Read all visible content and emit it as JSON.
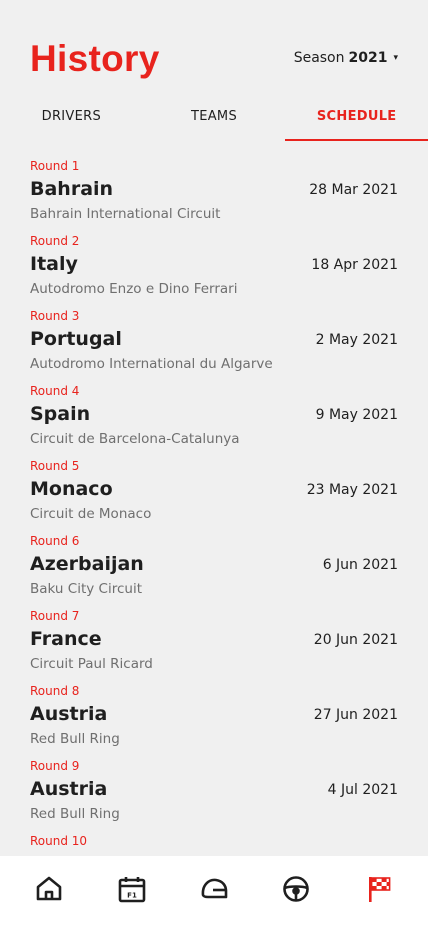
{
  "header": {
    "title": "History",
    "season_label": "Season",
    "season_year": "2021",
    "caret": "▾"
  },
  "tabs": [
    {
      "label": "DRIVERS",
      "active": false
    },
    {
      "label": "TEAMS",
      "active": false
    },
    {
      "label": "SCHEDULE",
      "active": true
    }
  ],
  "races": [
    {
      "round": "Round 1",
      "country": "Bahrain",
      "date": "28 Mar 2021",
      "circuit": "Bahrain International Circuit"
    },
    {
      "round": "Round 2",
      "country": "Italy",
      "date": "18 Apr 2021",
      "circuit": "Autodromo Enzo e Dino Ferrari"
    },
    {
      "round": "Round 3",
      "country": "Portugal",
      "date": "2 May 2021",
      "circuit": "Autodromo International du Algarve"
    },
    {
      "round": "Round 4",
      "country": "Spain",
      "date": "9 May 2021",
      "circuit": "Circuit de Barcelona-Catalunya"
    },
    {
      "round": "Round 5",
      "country": "Monaco",
      "date": "23 May 2021",
      "circuit": "Circuit de Monaco"
    },
    {
      "round": "Round 6",
      "country": "Azerbaijan",
      "date": "6 Jun 2021",
      "circuit": "Baku City Circuit"
    },
    {
      "round": "Round 7",
      "country": "France",
      "date": "20 Jun 2021",
      "circuit": "Circuit Paul Ricard"
    },
    {
      "round": "Round 8",
      "country": "Austria",
      "date": "27 Jun 2021",
      "circuit": "Red Bull Ring"
    },
    {
      "round": "Round 9",
      "country": "Austria",
      "date": "4 Jul 2021",
      "circuit": "Red Bull Ring"
    },
    {
      "round": "Round 10",
      "country": "",
      "date": "",
      "circuit": ""
    }
  ],
  "nav": [
    {
      "icon": "home-icon",
      "active": false
    },
    {
      "icon": "calendar-f1-icon",
      "active": false
    },
    {
      "icon": "helmet-icon",
      "active": false
    },
    {
      "icon": "steering-wheel-icon",
      "active": false
    },
    {
      "icon": "checkered-flag-icon",
      "active": true
    }
  ],
  "colors": {
    "accent": "#e8231d",
    "text": "#1f1f1f",
    "muted": "#6f6f6f",
    "background": "#f0f0f0"
  }
}
